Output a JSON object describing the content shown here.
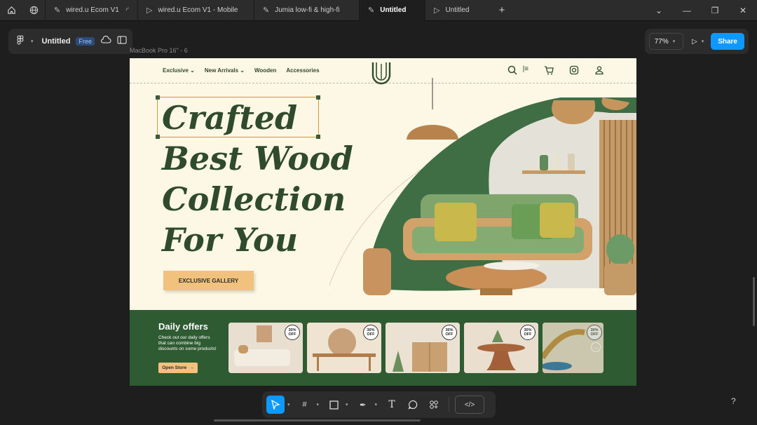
{
  "tabs": [
    {
      "label": "wired.u Ecom V1",
      "icon": "figma-file-icon"
    },
    {
      "label": "wired.u Ecom V1 - Mobile",
      "icon": "play-icon"
    },
    {
      "label": "Jumia low-fi & high-fi",
      "icon": "figma-file-icon"
    },
    {
      "label": "Untitled",
      "icon": "figma-file-icon",
      "active": true
    },
    {
      "label": "Untitled",
      "icon": "play-icon"
    }
  ],
  "file": {
    "title": "Untitled",
    "plan_badge": "Free"
  },
  "zoom": {
    "value": "77%"
  },
  "share_label": "Share",
  "frame_label": "MacBook Pro 16\" - 6",
  "site": {
    "nav": [
      "Exclusive",
      "New Arrivals",
      "Wooden",
      "Accessories"
    ],
    "hero_lines": [
      "Crafted",
      "Best Wood",
      "Collection",
      "For You"
    ],
    "gallery_button": "EXCLUSIVE GALLERY",
    "offers": {
      "title": "Daily offers",
      "description": "Check out our daily offers that can combine big discounts on some products!",
      "button": "Open Store",
      "badge_line1": "30%",
      "badge_line2": "OFF"
    }
  },
  "help_label": "?",
  "colors": {
    "accent": "#0d99ff",
    "brand_green": "#2f5b32",
    "cream": "#fdf8e6",
    "button_gold": "#f1c27d"
  }
}
